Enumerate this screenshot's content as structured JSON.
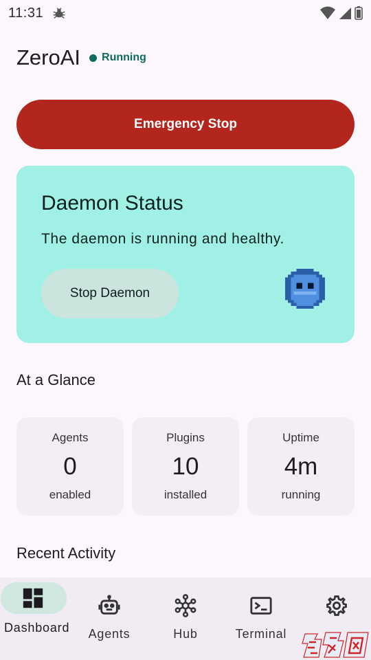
{
  "status_bar": {
    "time": "11:31"
  },
  "header": {
    "title": "ZeroAI",
    "status": "Running"
  },
  "emergency_label": "Emergency Stop",
  "daemon": {
    "title": "Daemon Status",
    "description": "The daemon is running and healthy.",
    "stop_label": "Stop Daemon"
  },
  "glance": {
    "title": "At a Glance",
    "stats": [
      {
        "label": "Agents",
        "value": "0",
        "sub": "enabled"
      },
      {
        "label": "Plugins",
        "value": "10",
        "sub": "installed"
      },
      {
        "label": "Uptime",
        "value": "4m",
        "sub": "running"
      }
    ]
  },
  "activity": {
    "title": "Recent Activity"
  },
  "nav": {
    "items": [
      {
        "label": "Dashboard",
        "icon": "dashboard-icon",
        "selected": true
      },
      {
        "label": "Agents",
        "icon": "robot-icon",
        "selected": false
      },
      {
        "label": "Hub",
        "icon": "hub-icon",
        "selected": false
      },
      {
        "label": "Terminal",
        "icon": "terminal-icon",
        "selected": false
      },
      {
        "label": "Settings",
        "icon": "gear-icon",
        "selected": false
      }
    ]
  },
  "colors": {
    "emergency": "#b3261e",
    "daemon_card": "#a1f0e6",
    "running": "#0f6b5e",
    "nav_pill": "#cfe7de"
  }
}
